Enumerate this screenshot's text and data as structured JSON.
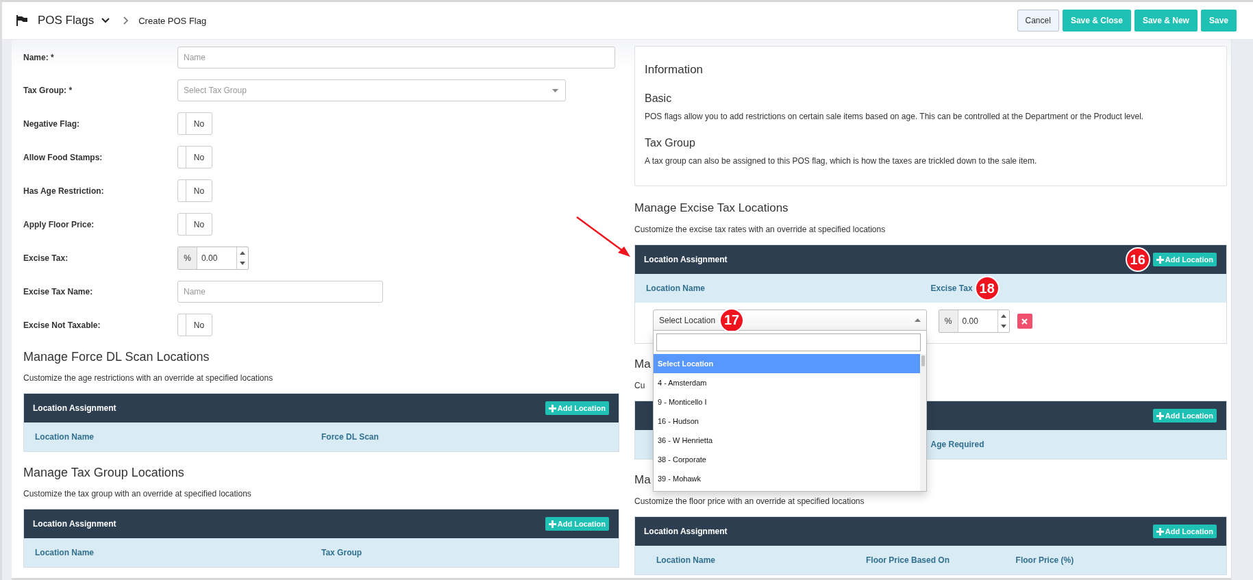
{
  "header": {
    "module": "POS Flags",
    "breadcrumb": "Create POS Flag",
    "buttons": [
      {
        "label": "Cancel",
        "kind": "default"
      },
      {
        "label": "Save & Close",
        "kind": "primary"
      },
      {
        "label": "Save & New",
        "kind": "primary"
      },
      {
        "label": "Save",
        "kind": "primary"
      }
    ]
  },
  "form": {
    "fields": [
      {
        "label": "Name: *",
        "kind": "text",
        "placeholder": "Name"
      },
      {
        "label": "Tax Group: *",
        "kind": "select",
        "placeholder": "Select Tax Group"
      },
      {
        "label": "Negative Flag:",
        "kind": "toggle",
        "on": false,
        "text": "No"
      },
      {
        "label": "Allow Food Stamps:",
        "kind": "toggle",
        "on": false,
        "text": "No"
      },
      {
        "label": "Has Age Restriction:",
        "kind": "toggle",
        "on": false,
        "text": "No"
      },
      {
        "label": "Apply Floor Price:",
        "kind": "toggle",
        "on": false,
        "text": "No"
      },
      {
        "label": "Excise Tax:",
        "kind": "percent",
        "addon": "%",
        "value": "0.00"
      },
      {
        "label": "Excise Tax Name:",
        "kind": "short_text",
        "placeholder": "Name"
      },
      {
        "label": "Excise Not Taxable:",
        "kind": "toggle",
        "on": false,
        "text": "No"
      }
    ]
  },
  "left_sections": [
    {
      "title": "Manage Force DL Scan Locations",
      "description": "Customize the age restrictions with an override at specified locations",
      "panel": {
        "title": "Location Assignment",
        "add_button": "Add Location",
        "columns": [
          {
            "label": "Location Name"
          },
          {
            "label": "Force DL Scan"
          }
        ]
      }
    },
    {
      "title": "Manage Tax Group Locations",
      "description": "Customize the tax group with an override at specified locations",
      "panel": {
        "title": "Location Assignment",
        "add_button": "Add Location",
        "columns": [
          {
            "label": "Location Name"
          },
          {
            "label": "Tax Group"
          }
        ]
      }
    }
  ],
  "information": {
    "title": "Information",
    "blocks": [
      {
        "heading": "Basic",
        "text": "POS flags allow you to add restrictions on certain sale items based on age. This can be controlled at the Department or the Product level."
      },
      {
        "heading": "Tax Group",
        "text": "A tax group can also be assigned to this POS flag, which is how the taxes are trickled down to the sale item."
      }
    ]
  },
  "right_sections": [
    {
      "title": "Manage Excise Tax Locations",
      "description": "Customize the excise tax rates with an override at specified locations",
      "panel": {
        "title": "Location Assignment",
        "callout": "16",
        "add_button": "Add Location",
        "columns": [
          {
            "label": "Location Name"
          },
          {
            "label": "Excise Tax",
            "callout": "18"
          }
        ],
        "rows": [
          {
            "location": {
              "value": "Select Location",
              "callout": "17",
              "open": true,
              "options": [
                {
                  "label": "Select Location",
                  "selected": true
                },
                {
                  "label": "4 - Amsterdam",
                  "selected": false
                },
                {
                  "label": "9 - Monticello I",
                  "selected": false
                },
                {
                  "label": "16 - Hudson",
                  "selected": false
                },
                {
                  "label": "36 - W Henrietta",
                  "selected": false
                },
                {
                  "label": "38 - Corporate",
                  "selected": false
                },
                {
                  "label": "39 - Mohawk",
                  "selected": false
                }
              ]
            },
            "addon": "%",
            "tax": "0.00"
          }
        ]
      }
    },
    {
      "title": "Ma",
      "description": "Cu",
      "panel": {
        "add_button": "Add Location",
        "columns": [
          {
            "label": "Age Required"
          }
        ]
      }
    },
    {
      "title": "Ma",
      "description": "Customize the floor price with an override at specified locations",
      "panel": {
        "title": "Location Assignment",
        "add_button": "Add Location",
        "columns": [
          {
            "label": "Location Name"
          },
          {
            "label": "Floor Price Based On"
          },
          {
            "label": "Floor Price (%)"
          }
        ]
      }
    }
  ]
}
